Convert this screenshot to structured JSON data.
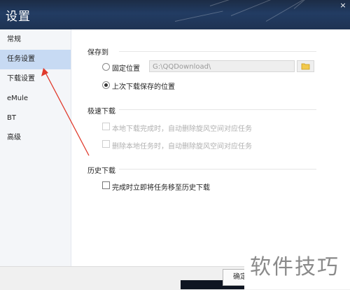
{
  "window": {
    "title": "设置",
    "close_glyph": "×"
  },
  "sidebar": {
    "items": [
      {
        "label": "常规"
      },
      {
        "label": "任务设置"
      },
      {
        "label": "下载设置"
      },
      {
        "label": "eMule"
      },
      {
        "label": "BT"
      },
      {
        "label": "高级"
      }
    ],
    "active_index": 1
  },
  "save_to": {
    "heading": "保存到",
    "fixed_label": "固定位置",
    "fixed_path": "G:\\QQDownload\\",
    "last_label": "上次下载保存的位置",
    "selected": "last"
  },
  "speed": {
    "heading": "极速下载",
    "opt1": "本地下载完成时，自动删除旋风空间对应任务",
    "opt2": "删除本地任务时，自动删除旋风空间对应任务"
  },
  "history": {
    "heading": "历史下载",
    "opt1": "完成时立即将任务移至历史下载"
  },
  "footer": {
    "ok_label": "确定"
  },
  "watermark": {
    "text": "软件技巧"
  },
  "annotation": {
    "color": "#e03a2c"
  },
  "colors": {
    "active_nav": "#c7daf3",
    "title_bar": "#1e3353"
  }
}
